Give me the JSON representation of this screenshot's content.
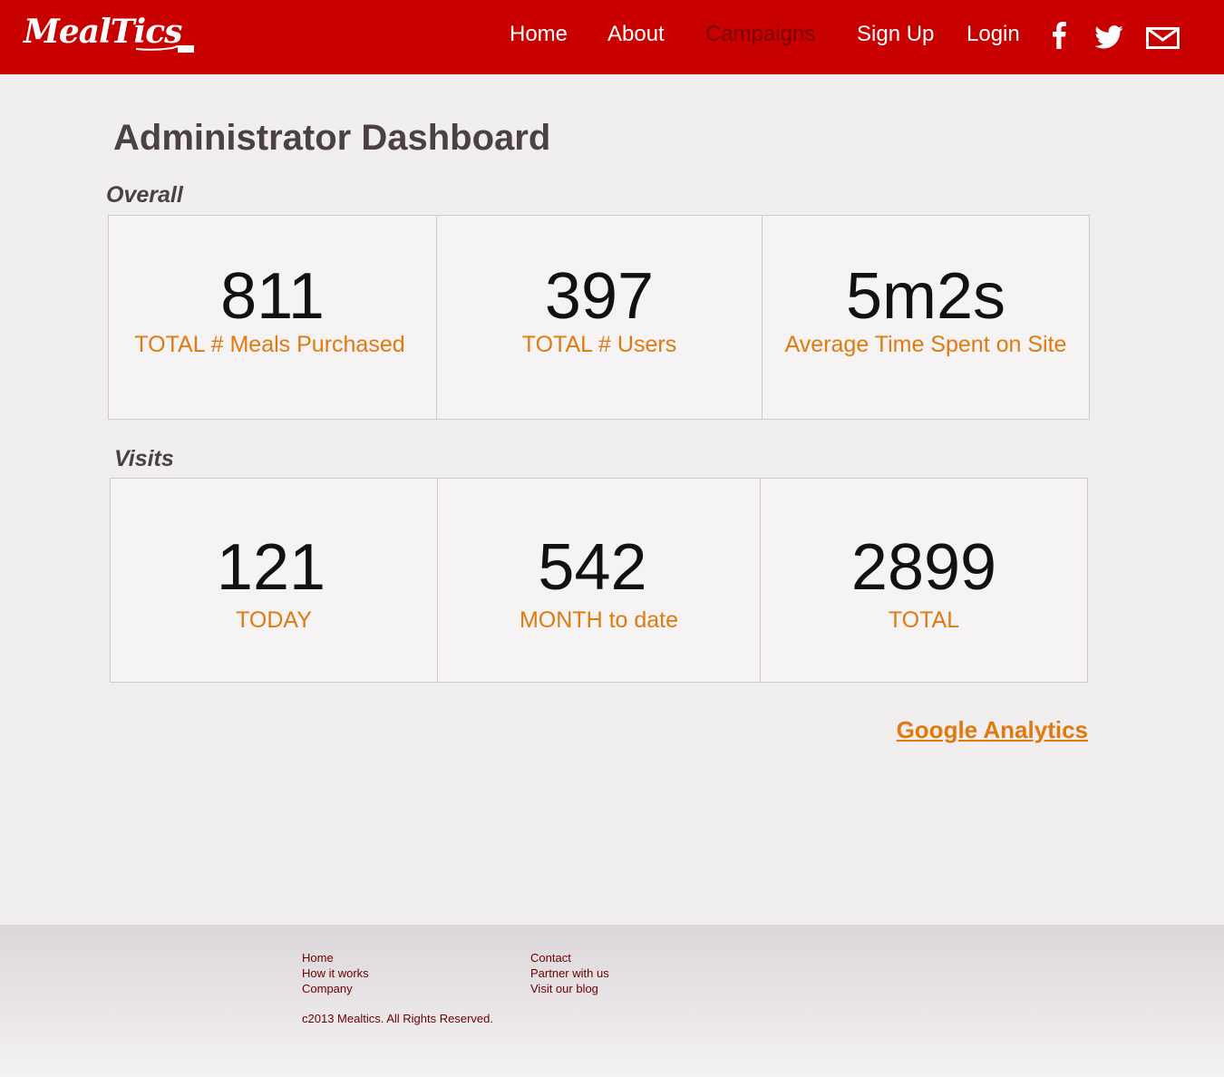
{
  "header": {
    "logo_text": "MealTics",
    "nav": [
      {
        "label": "Home"
      },
      {
        "label": "About"
      },
      {
        "label": "Campaigns"
      },
      {
        "label": "Sign Up"
      },
      {
        "label": "Login"
      }
    ],
    "social": [
      "facebook-icon",
      "twitter-icon",
      "mail-icon"
    ],
    "colors": {
      "bar": "#c80000",
      "active_nav": "#7a0000"
    }
  },
  "main": {
    "title": "Administrator Dashboard",
    "overall": {
      "label": "Overall",
      "stats": [
        {
          "value": "811",
          "label": "TOTAL # Meals Purchased"
        },
        {
          "value": "397",
          "label": "TOTAL # Users"
        },
        {
          "value": "5m2s",
          "label": "Average Time Spent on Site"
        }
      ]
    },
    "visits": {
      "label": "Visits",
      "stats": [
        {
          "value": "121",
          "label": "TODAY"
        },
        {
          "value": "542",
          "label": "MONTH to date"
        },
        {
          "value": "2899",
          "label": "TOTAL"
        }
      ]
    },
    "analytics_link": "Google Analytics"
  },
  "footer": {
    "col1": [
      "Home",
      "How it works",
      "Company"
    ],
    "col2": [
      "Contact",
      "Partner with us",
      "Visit our blog"
    ],
    "copyright": "c2013 Mealtics. All Rights Reserved."
  }
}
